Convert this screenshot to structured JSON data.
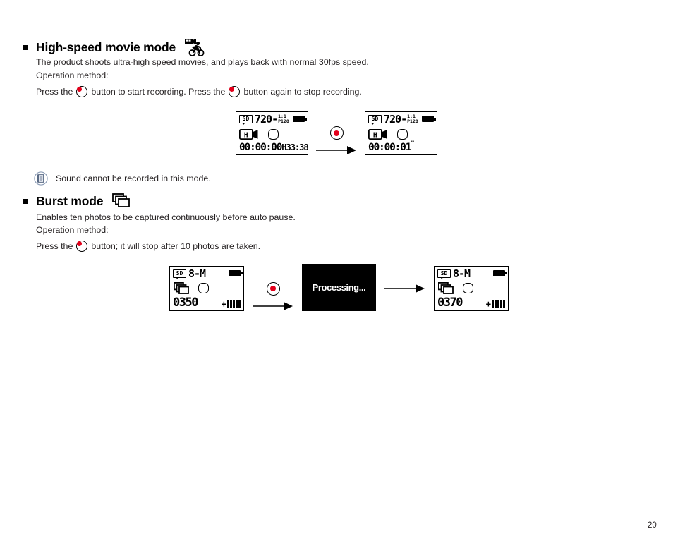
{
  "page": {
    "number": "20"
  },
  "sections": [
    {
      "id": "high-speed-movie",
      "heading": "High-speed movie mode",
      "icon": "camcorder-cyclist-icon",
      "description": "The product shoots ultra-high speed movies, and plays back with normal 30fps speed.",
      "operation_label": "Operation method:",
      "press_parts": {
        "before": "Press the",
        "middle": "button to start recording. Press the",
        "after": "button again to stop recording."
      },
      "note": {
        "icon": "note-document-icon",
        "text": "Sound cannot be recorded in this mode."
      },
      "flow": [
        {
          "type": "lcd-movie",
          "name": "lcd-before-recording",
          "card_badge": "SD",
          "resolution": "720-",
          "sup_top": "1:1",
          "sup_bottom": "P120",
          "battery": "battery-full-icon",
          "mode_icon": "high-speed-camcorder-icon",
          "mode_letter": "H",
          "shutter_icon": "shutter-octagon-icon",
          "timer": "00:00:00",
          "timer_mark": "",
          "remaining": "H33:38"
        },
        {
          "type": "arrow",
          "name": "record-arrow-start",
          "button_icon": "record-button-icon"
        },
        {
          "type": "lcd-movie",
          "name": "lcd-recording",
          "card_badge": "SD",
          "resolution": "720-",
          "sup_top": "1:1",
          "sup_bottom": "P120",
          "battery": "battery-full-icon",
          "mode_icon": "high-speed-camcorder-icon",
          "mode_letter": "H",
          "shutter_icon": "shutter-octagon-icon",
          "timer": "00:00:01",
          "timer_mark": "\"",
          "remaining": ""
        }
      ]
    },
    {
      "id": "burst-mode",
      "heading": "Burst mode",
      "icon": "burst-frames-icon",
      "description": "Enables ten photos to be captured continuously before auto pause.",
      "operation_label": "Operation method:",
      "press_parts": {
        "before": "Press the",
        "after": "button; it will stop after 10 photos are taken."
      },
      "flow": [
        {
          "type": "lcd-burst",
          "name": "lcd-before-burst",
          "card_badge": "SD",
          "resolution": "8-M",
          "battery": "battery-full-icon",
          "mode_icon": "burst-frames-icon",
          "shutter_icon": "shutter-octagon-icon",
          "counter": "0350",
          "meter_plus": "+",
          "meter_bars": 5
        },
        {
          "type": "arrow",
          "name": "record-arrow-burst",
          "button_icon": "record-button-icon"
        },
        {
          "type": "processing",
          "name": "lcd-processing",
          "text": "Processing..."
        },
        {
          "type": "arrow-plain",
          "name": "result-arrow"
        },
        {
          "type": "lcd-burst",
          "name": "lcd-after-burst",
          "card_badge": "SD",
          "resolution": "8-M",
          "battery": "battery-full-icon",
          "mode_icon": "burst-frames-icon",
          "shutter_icon": "shutter-octagon-icon",
          "counter": "0370",
          "meter_plus": "+",
          "meter_bars": 5
        }
      ]
    }
  ],
  "colors": {
    "record_red": "#e3001b",
    "text": "#231f20",
    "lcd_border": "#000000"
  }
}
